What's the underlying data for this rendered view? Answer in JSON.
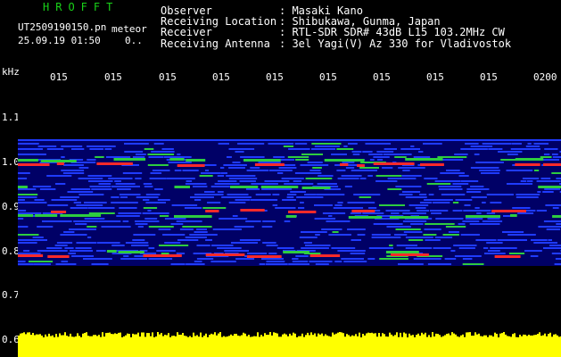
{
  "header": {
    "brand": "HROFFT",
    "file_name": "UT2509190150.pn",
    "meteor_tag": "meteor",
    "datetime": "25.09.19 01:50",
    "count": "0.."
  },
  "info": [
    {
      "key": "Observer",
      "value": ": Masaki Kano"
    },
    {
      "key": "Receiving Location",
      "value": ": Shibukawa, Gunma, Japan"
    },
    {
      "key": "Receiver",
      "value": ": RTL-SDR SDR# 43dB L15 103.2MHz CW"
    },
    {
      "key": "Receiving Antenna",
      "value": ": 3el Yagi(V) Az 330 for Vladivostok"
    }
  ],
  "axis": {
    "unit": "kHz",
    "y_ticks": [
      "1.1",
      "1.0",
      "0.9",
      "0.8",
      "0.7",
      "0.6"
    ],
    "x_ticks": [
      "015",
      "015",
      "015",
      "015",
      "015",
      "015",
      "015",
      "015",
      "015",
      "0200"
    ]
  },
  "colors": {
    "background": "#000000",
    "noise_floor": "#000066",
    "band_blue": "#1f3bff",
    "band_green": "#2ecc40",
    "band_red": "#ff2a2a",
    "audio_level": "#ffff00",
    "brand_text": "#19d219"
  }
}
